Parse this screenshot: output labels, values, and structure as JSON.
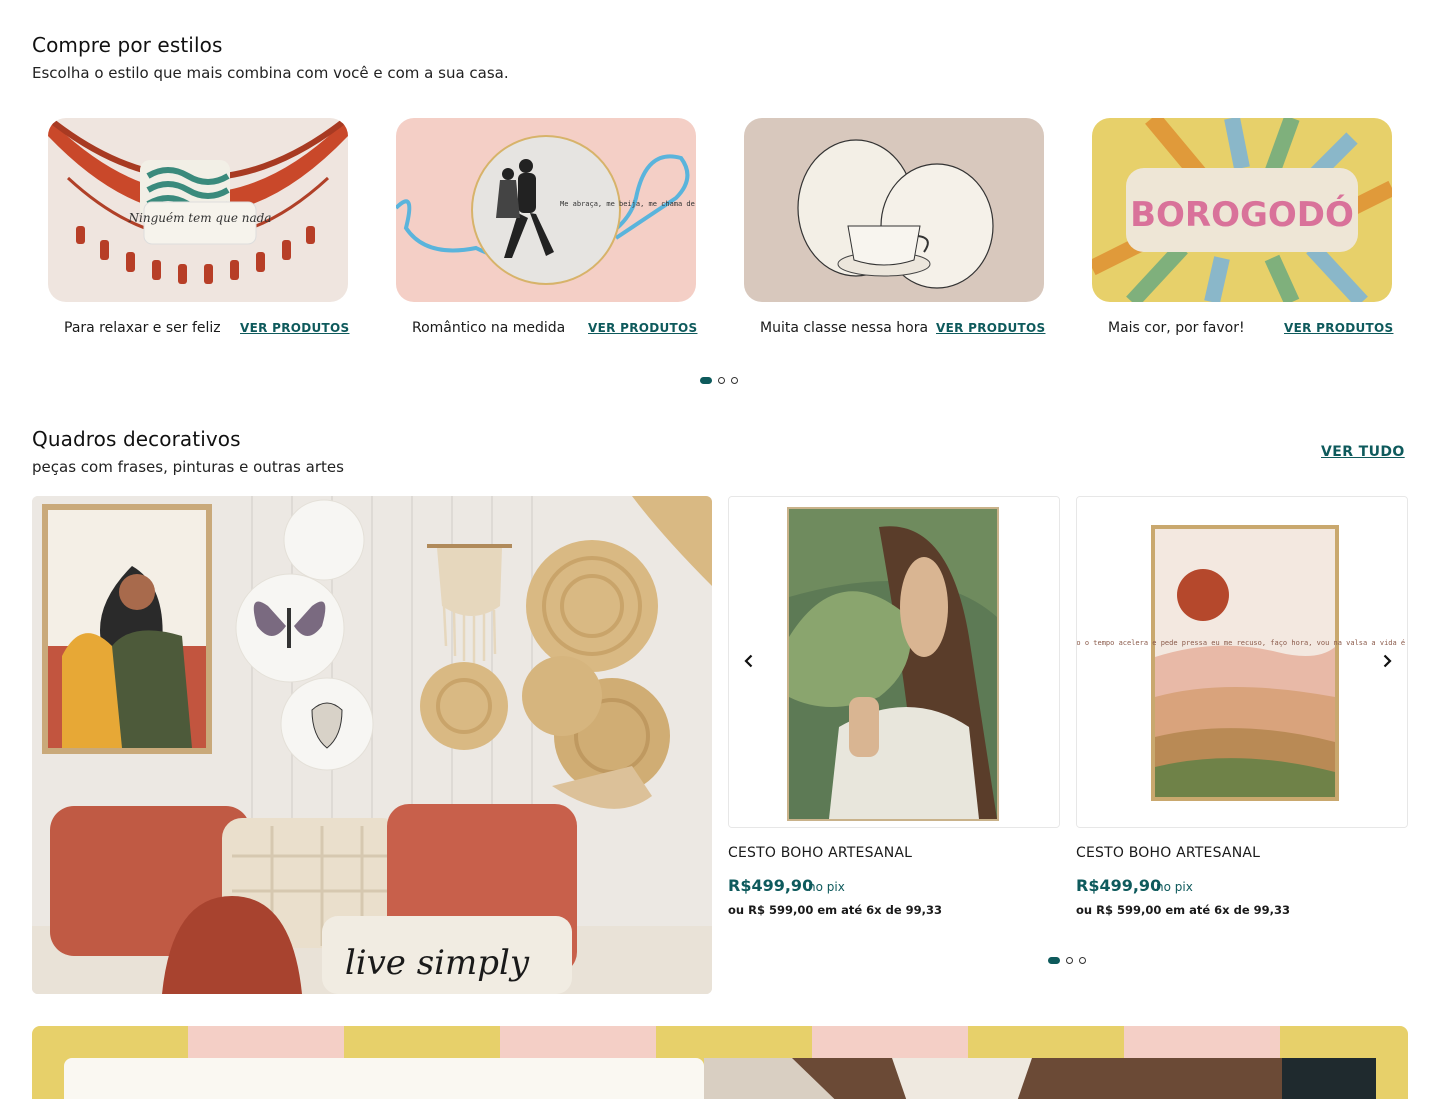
{
  "styles_section": {
    "title": "Compre por estilos",
    "subtitle": "Escolha o estilo que mais combina com você e com a sua casa.",
    "cards": [
      {
        "label": "Para relaxar e ser feliz",
        "link": "VER PRODUTOS",
        "bg": "#efe5df"
      },
      {
        "label": "Romântico na medida",
        "link": "VER PRODUTOS",
        "bg": "#f4cfc6"
      },
      {
        "label": "Muita classe nessa hora",
        "link": "VER PRODUTOS",
        "bg": "#d8c8bd"
      },
      {
        "label": "Mais cor, por favor!",
        "link": "VER PRODUTOS",
        "bg": "#e7d06a"
      }
    ],
    "art_text": {
      "pillow_1": "Ninguém tem que nada",
      "plate_2": "Me abraça, me beija, me chama de meu amor",
      "pillow_4": "BOROGODÓ"
    }
  },
  "quadros_section": {
    "title": "Quadros decorativos",
    "subtitle": "peças com frases, pinturas e outras artes",
    "see_all": "VER TUDO",
    "hero_art_text": "live simply",
    "products": [
      {
        "name": "CESTO BOHO ARTESANAL",
        "price": "R$499,90",
        "pix": "no pix",
        "installments": "ou R$ 599,00 em até 6x de 99,33"
      },
      {
        "name": "CESTO BOHO ARTESANAL",
        "price": "R$499,90",
        "pix": "no pix",
        "installments": "ou R$ 599,00 em até 6x de 99,33",
        "art_text": "enquanto o tempo acelera e pede pressa eu me recuso, faço hora, vou na valsa a vida é tão rara"
      }
    ]
  },
  "colors": {
    "accent": "#0e5a5c",
    "banner_yellow": "#e7d06a",
    "banner_pink": "#f4cfc6"
  },
  "icons": {
    "prev": "chevron-left-icon",
    "next": "chevron-right-icon"
  }
}
